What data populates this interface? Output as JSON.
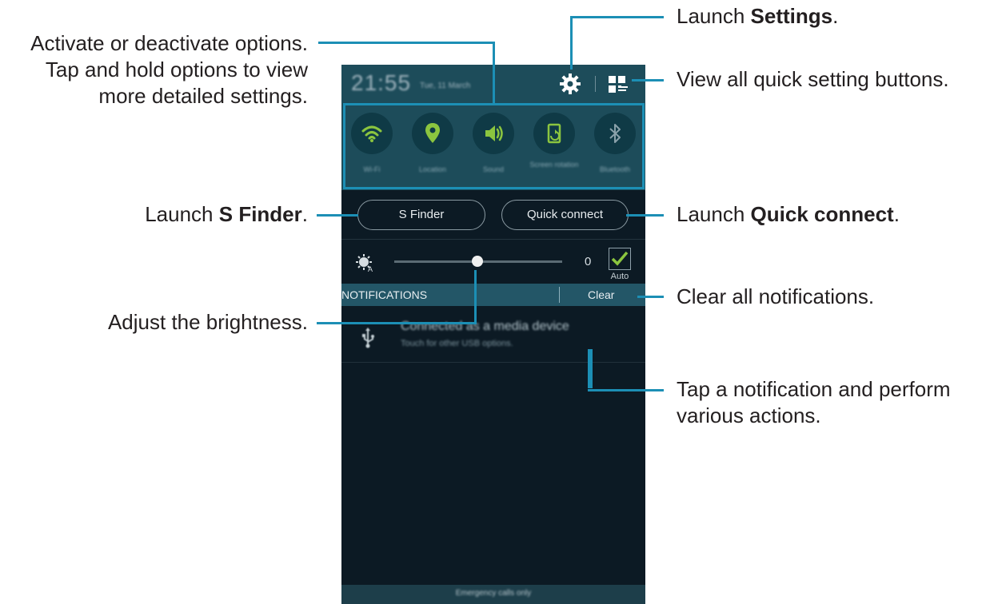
{
  "status_bar": {
    "time": "21:55",
    "date": "Tue, 11 March"
  },
  "quick_settings": [
    {
      "label": "Wi-Fi",
      "icon": "wifi-icon",
      "active": true
    },
    {
      "label": "Location",
      "icon": "location-icon",
      "active": true
    },
    {
      "label": "Sound",
      "icon": "sound-icon",
      "active": true
    },
    {
      "label": "Screen rotation",
      "icon": "screen-rotation-icon",
      "active": true
    },
    {
      "label": "Bluetooth",
      "icon": "bluetooth-icon",
      "active": false
    }
  ],
  "buttons": {
    "s_finder": "S Finder",
    "quick_connect": "Quick connect"
  },
  "brightness": {
    "value": "0",
    "auto_label": "Auto",
    "auto_checked": true,
    "level": 0.5
  },
  "notifications": {
    "header": "NOTIFICATIONS",
    "clear_label": "Clear",
    "items": [
      {
        "title": "Connected as a media device",
        "subtitle": "Touch for other USB options."
      }
    ]
  },
  "footer": "Emergency calls only",
  "annotations": {
    "options_1": "Activate or deactivate options.",
    "options_2": "Tap and hold options to view",
    "options_3": "more detailed settings.",
    "settings_prefix": "Launch ",
    "settings_bold": "Settings",
    "settings_suffix": ".",
    "view_all": "View all quick setting buttons.",
    "sfinder_prefix": "Launch ",
    "sfinder_bold": "S Finder",
    "sfinder_suffix": ".",
    "qc_prefix": "Launch ",
    "qc_bold": "Quick connect",
    "qc_suffix": ".",
    "brightness": "Adjust the brightness.",
    "clear_all": "Clear all notifications.",
    "tap_1": "Tap a notification and perform",
    "tap_2": "various actions."
  },
  "colors": {
    "accent_green": "#8bc53f",
    "annotation_line": "#1c8fb5",
    "panel_teal": "#1d4c5a"
  }
}
